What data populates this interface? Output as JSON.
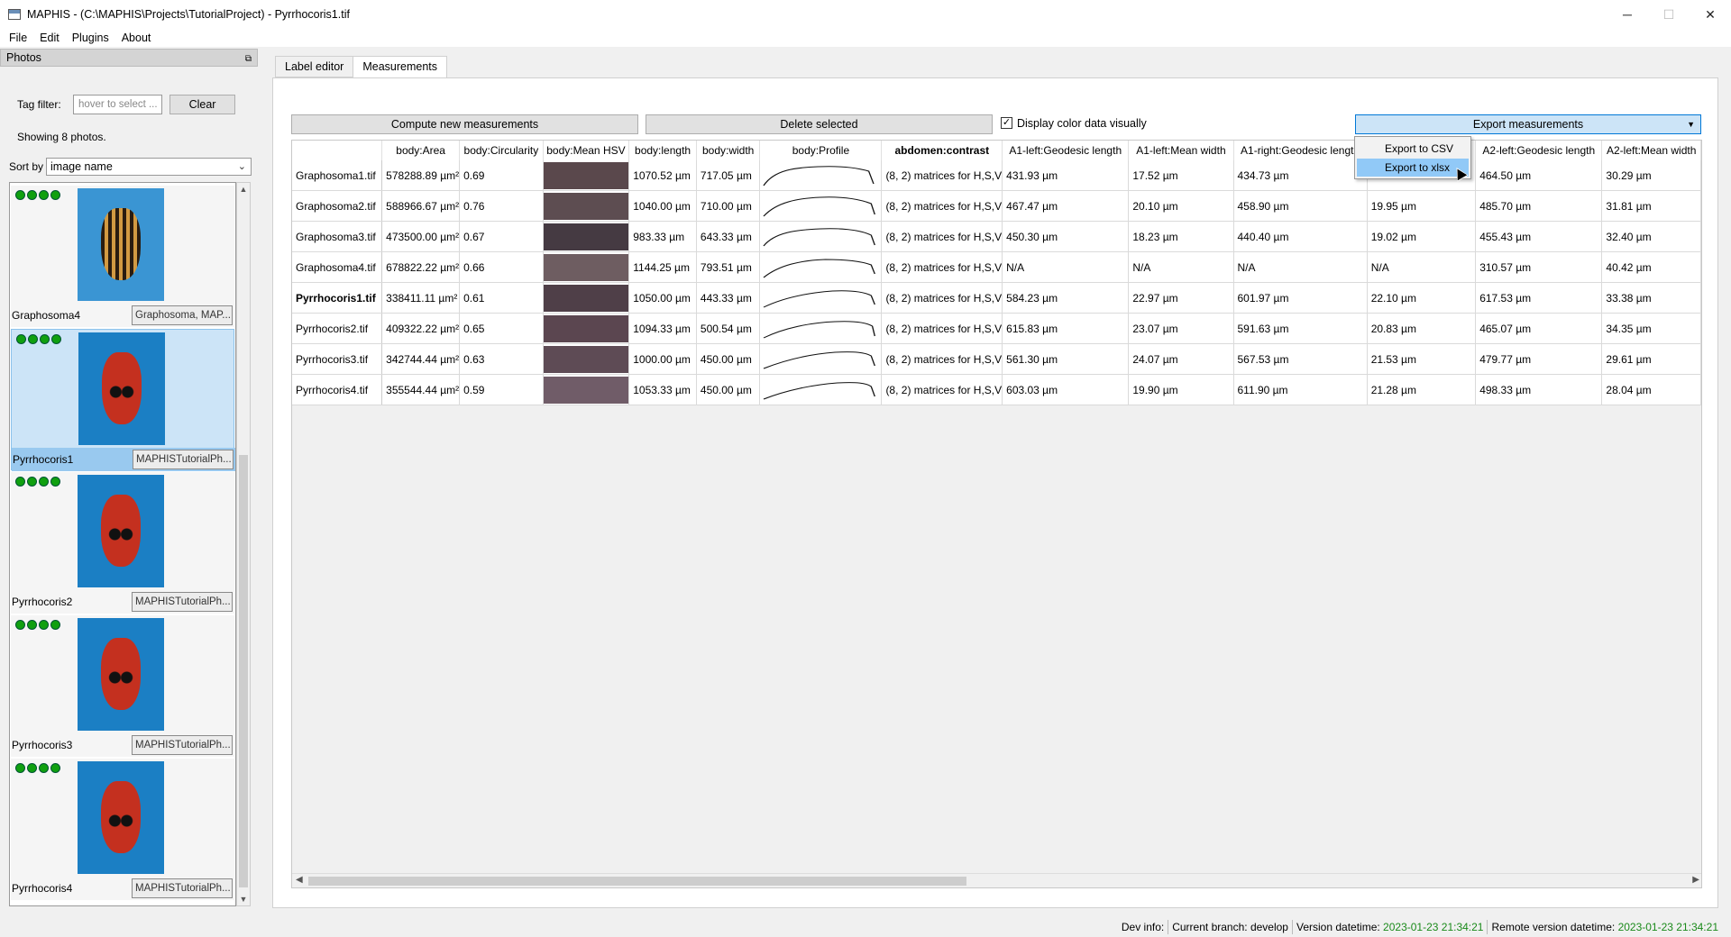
{
  "window": {
    "title": "MAPHIS - (C:\\MAPHIS\\Projects\\TutorialProject) - Pyrrhocoris1.tif",
    "minimize": "─",
    "maximize": "☐",
    "close": "✕"
  },
  "menu": [
    "File",
    "Edit",
    "Plugins",
    "About"
  ],
  "photos_panel": {
    "title": "Photos",
    "float_icon": "⧉",
    "tag_filter_label": "Tag filter:",
    "tag_filter_placeholder": "hover to select ...",
    "clear_label": "Clear",
    "showing": "Showing 8 photos.",
    "sort_label": "Sort by",
    "sort_value": "image name",
    "chevron": "⌄",
    "scroll_up": "▲",
    "scroll_down": "▼",
    "thumbnails": [
      {
        "name": "Graphosoma4",
        "tags": "Graphosoma, MAP...",
        "selected": false
      },
      {
        "name": "Pyrrhocoris1",
        "tags": "MAPHISTutorialPh...",
        "selected": true
      },
      {
        "name": "Pyrrhocoris2",
        "tags": "MAPHISTutorialPh...",
        "selected": false
      },
      {
        "name": "Pyrrhocoris3",
        "tags": "MAPHISTutorialPh...",
        "selected": false
      },
      {
        "name": "Pyrrhocoris4",
        "tags": "MAPHISTutorialPh...",
        "selected": false
      }
    ]
  },
  "tabs": [
    "Label editor",
    "Measurements"
  ],
  "toolbar": {
    "compute_label": "Compute new measurements",
    "delete_label": "Delete selected",
    "display_color_label": "Display color data visually",
    "checkmark": "✓",
    "export_label": "Export measurements",
    "export_arrow": "▼"
  },
  "export_menu": [
    "Export to CSV",
    "Export to xlsx"
  ],
  "table": {
    "columns": [
      "body:Area",
      "body:Circularity",
      "body:Mean HSV",
      "body:length",
      "body:width",
      "body:Profile",
      "abdomen:contrast",
      "A1-left:Geodesic length",
      "A1-left:Mean width",
      "A1-right:Geodesic length",
      "",
      "A2-left:Geodesic length",
      "A2-left:Mean width"
    ],
    "rows": [
      {
        "name": "Graphosoma1.tif",
        "bold": false,
        "area": "578288.89 µm²",
        "circ": "0.69",
        "hsv": "#5a484c",
        "length": "1070.52 µm",
        "width": "717.05 µm",
        "contrast": "(8, 2) matrices for H,S,V",
        "a1l_geo": "431.93 µm",
        "a1l_width": "17.52 µm",
        "a1r_geo": "434.73 µm",
        "col11": "",
        "a2l_geo": "464.50 µm",
        "a2l_width": "30.29 µm"
      },
      {
        "name": "Graphosoma2.tif",
        "bold": false,
        "area": "588966.67 µm²",
        "circ": "0.76",
        "hsv": "#5d4d51",
        "length": "1040.00 µm",
        "width": "710.00 µm",
        "contrast": "(8, 2) matrices for H,S,V",
        "a1l_geo": "467.47 µm",
        "a1l_width": "20.10 µm",
        "a1r_geo": "458.90 µm",
        "col11": "19.95 µm",
        "a2l_geo": "485.70 µm",
        "a2l_width": "31.81 µm"
      },
      {
        "name": "Graphosoma3.tif",
        "bold": false,
        "area": "473500.00 µm²",
        "circ": "0.67",
        "hsv": "#453a42",
        "length": "983.33 µm",
        "width": "643.33 µm",
        "contrast": "(8, 2) matrices for H,S,V",
        "a1l_geo": "450.30 µm",
        "a1l_width": "18.23 µm",
        "a1r_geo": "440.40 µm",
        "col11": "19.02 µm",
        "a2l_geo": "455.43 µm",
        "a2l_width": "32.40 µm"
      },
      {
        "name": "Graphosoma4.tif",
        "bold": false,
        "area": "678822.22 µm²",
        "circ": "0.66",
        "hsv": "#6e5d61",
        "length": "1144.25 µm",
        "width": "793.51 µm",
        "contrast": "(8, 2) matrices for H,S,V",
        "a1l_geo": "N/A",
        "a1l_width": "N/A",
        "a1r_geo": "N/A",
        "col11": "N/A",
        "a2l_geo": "310.57 µm",
        "a2l_width": "40.42 µm"
      },
      {
        "name": "Pyrrhocoris1.tif",
        "bold": true,
        "area": "338411.11 µm²",
        "circ": "0.61",
        "hsv": "#4f3f48",
        "length": "1050.00 µm",
        "width": "443.33 µm",
        "contrast": "(8, 2) matrices for H,S,V",
        "a1l_geo": "584.23 µm",
        "a1l_width": "22.97 µm",
        "a1r_geo": "601.97 µm",
        "col11": "22.10 µm",
        "a2l_geo": "617.53 µm",
        "a2l_width": "33.38 µm"
      },
      {
        "name": "Pyrrhocoris2.tif",
        "bold": false,
        "area": "409322.22 µm²",
        "circ": "0.65",
        "hsv": "#5b4650",
        "length": "1094.33 µm",
        "width": "500.54 µm",
        "contrast": "(8, 2) matrices for H,S,V",
        "a1l_geo": "615.83 µm",
        "a1l_width": "23.07 µm",
        "a1r_geo": "591.63 µm",
        "col11": "20.83 µm",
        "a2l_geo": "465.07 µm",
        "a2l_width": "34.35 µm"
      },
      {
        "name": "Pyrrhocoris3.tif",
        "bold": false,
        "area": "342744.44 µm²",
        "circ": "0.63",
        "hsv": "#5e4b55",
        "length": "1000.00 µm",
        "width": "450.00 µm",
        "contrast": "(8, 2) matrices for H,S,V",
        "a1l_geo": "561.30 µm",
        "a1l_width": "24.07 µm",
        "a1r_geo": "567.53 µm",
        "col11": "21.53 µm",
        "a2l_geo": "479.77 µm",
        "a2l_width": "29.61 µm"
      },
      {
        "name": "Pyrrhocoris4.tif",
        "bold": false,
        "area": "355544.44 µm²",
        "circ": "0.59",
        "hsv": "#705c68",
        "length": "1053.33 µm",
        "width": "450.00 µm",
        "contrast": "(8, 2) matrices for H,S,V",
        "a1l_geo": "603.03 µm",
        "a1l_width": "19.90 µm",
        "a1r_geo": "611.90 µm",
        "col11": "21.28 µm",
        "a2l_geo": "498.33 µm",
        "a2l_width": "28.04 µm"
      }
    ]
  },
  "hscroll": {
    "left": "◀",
    "right": "▶"
  },
  "statusbar": {
    "dev_info": "Dev info:",
    "branch_label": "Current branch:",
    "branch": "develop",
    "version_label": "Version datetime:",
    "version": "2023-01-23 21:34:21",
    "remote_label": "Remote version datetime:",
    "remote": "2023-01-23 21:34:21"
  }
}
